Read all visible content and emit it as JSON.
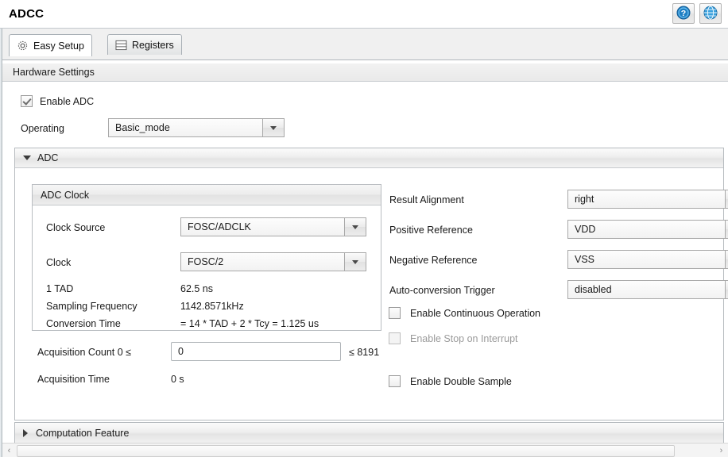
{
  "window": {
    "title": "ADCC",
    "buttons": [
      {
        "name": "help-button",
        "icon": "question-circle-icon",
        "label": "?"
      },
      {
        "name": "globe-button",
        "icon": "globe-icon",
        "label": ""
      }
    ]
  },
  "tabs": [
    {
      "label": "Easy Setup",
      "icon": "gear-icon",
      "active": true
    },
    {
      "label": "Registers",
      "icon": "registers-icon",
      "active": false
    }
  ],
  "section_band": {
    "label": "Hardware Settings"
  },
  "enable_adc": {
    "label": "Enable ADC",
    "checked": true
  },
  "operating": {
    "label": "Operating",
    "value": "Basic_mode"
  },
  "adc_panel": {
    "title": "ADC",
    "expanded": true,
    "clock_group": {
      "title": "ADC Clock",
      "clock_source": {
        "label": "Clock Source",
        "value": "FOSC/ADCLK"
      },
      "clock": {
        "label": "Clock",
        "value": "FOSC/2"
      },
      "stats": [
        {
          "label": "1 TAD",
          "value": "62.5 ns"
        },
        {
          "label": "Sampling Frequency",
          "value": "1142.8571kHz"
        },
        {
          "label": "Conversion Time",
          "value": "= 14 * TAD + 2 * Tcy = 1.125 us"
        }
      ]
    },
    "acquisition": {
      "count_label": "Acquisition Count 0  ≤",
      "count_value": "0",
      "count_max": "≤ 8191",
      "time_label": "Acquisition Time",
      "time_value": "0 s"
    },
    "right_fields": [
      {
        "label": "Result Alignment",
        "value": "right"
      },
      {
        "label": "Positive Reference",
        "value": "VDD"
      },
      {
        "label": "Negative Reference",
        "value": "VSS"
      },
      {
        "label": "Auto-conversion Trigger",
        "value": "disabled"
      }
    ],
    "right_checkboxes": [
      {
        "label": "Enable Continuous Operation",
        "checked": false,
        "disabled": false
      },
      {
        "label": "Enable Stop on Interrupt",
        "checked": false,
        "disabled": true
      },
      {
        "label": "Enable Double Sample",
        "checked": false,
        "disabled": false
      }
    ]
  },
  "computation_panel": {
    "title": "Computation Feature",
    "expanded": false
  },
  "scrollbar": {
    "left_arrow": "‹",
    "right_arrow": "›"
  },
  "colors": {
    "accent_blue": "#2f8fd4",
    "panel_bg": "#ffffff",
    "band_bg": "#ececec",
    "border": "#b6bbbf"
  }
}
